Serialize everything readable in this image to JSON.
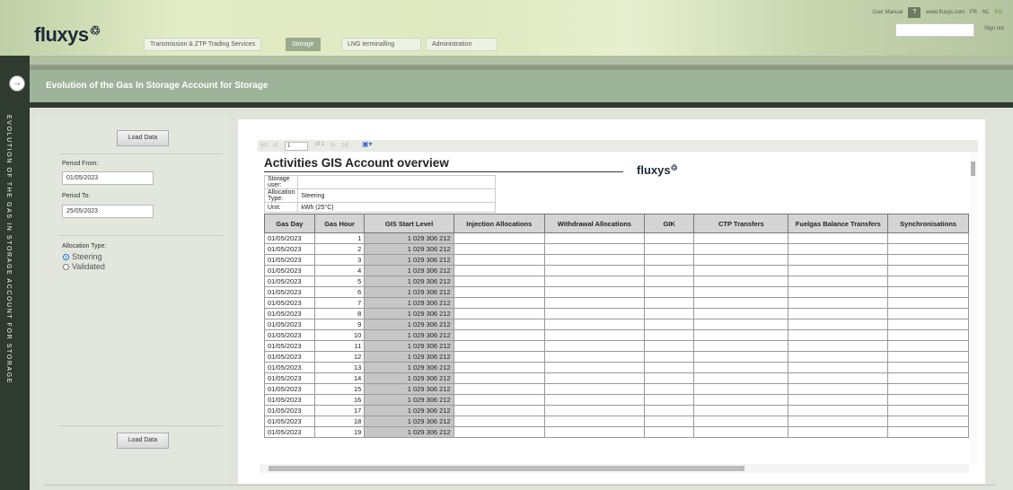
{
  "brand": {
    "logo_text": "fluxys",
    "logo_mark": "♲",
    "brand_color": "#1c2a3a",
    "accent": "#9db39a"
  },
  "nav": {
    "tabs": [
      {
        "label": "Transmission & ZTP Trading Services",
        "active": false
      },
      {
        "label": "Storage",
        "active": true
      },
      {
        "label": "LNG terminalling",
        "active": false
      },
      {
        "label": "Administration",
        "active": false
      }
    ]
  },
  "utility": {
    "user_manual": "User Manual",
    "help": "?",
    "website": "www.fluxys.com",
    "languages": [
      "FR",
      "NL",
      "EN"
    ],
    "active_language": "EN",
    "sign_out": "Sign out"
  },
  "page": {
    "title": "Evolution of the Gas In Storage Account for Storage",
    "side_label": "EVOLUTION OF THE GAS IN STORAGE ACCOUNT FOR STORAGE",
    "expand_icon": "arrow-right-icon"
  },
  "filters": {
    "load_button": "Load Data",
    "period_from_label": "Period From:",
    "period_from_value": "01/05/2023",
    "period_to_label": "Period To:",
    "period_to_value": "25/05/2023",
    "allocation_label": "Allocation Type:",
    "allocation_options": [
      {
        "label": "Steering",
        "selected": true
      },
      {
        "label": "Validated",
        "selected": false
      }
    ]
  },
  "viewer_toolbar": {
    "current_page": "1",
    "page_count_text": "of 1",
    "icons": [
      "first-page-icon",
      "prev-page-icon",
      "next-page-icon",
      "last-page-icon",
      "export-icon"
    ]
  },
  "report": {
    "title": "Activities GIS Account overview",
    "logo_text": "fluxys",
    "meta": [
      {
        "label": "Storage user:",
        "value": ""
      },
      {
        "label": "Allocation Type:",
        "value": "Steering"
      },
      {
        "label": "Unit:",
        "value": "kWh (25°C)"
      }
    ],
    "columns": [
      "Gas Day",
      "Gas Hour",
      "GIS Start Level",
      "Injection Allocations",
      "Withdrawal Allocations",
      "GIK",
      "CTP Transfers",
      "Fuelgas Balance Transfers",
      "Synchronisations"
    ],
    "rows": [
      {
        "day": "01/05/2023",
        "hour": "1",
        "level": "1 029 306 212"
      },
      {
        "day": "01/05/2023",
        "hour": "2",
        "level": "1 029 306 212"
      },
      {
        "day": "01/05/2023",
        "hour": "3",
        "level": "1 029 306 212"
      },
      {
        "day": "01/05/2023",
        "hour": "4",
        "level": "1 029 306 212"
      },
      {
        "day": "01/05/2023",
        "hour": "5",
        "level": "1 029 306 212"
      },
      {
        "day": "01/05/2023",
        "hour": "6",
        "level": "1 029 306 212"
      },
      {
        "day": "01/05/2023",
        "hour": "7",
        "level": "1 029 306 212"
      },
      {
        "day": "01/05/2023",
        "hour": "8",
        "level": "1 029 306 212"
      },
      {
        "day": "01/05/2023",
        "hour": "9",
        "level": "1 029 306 212"
      },
      {
        "day": "01/05/2023",
        "hour": "10",
        "level": "1 029 306 212"
      },
      {
        "day": "01/05/2023",
        "hour": "11",
        "level": "1 029 306 212"
      },
      {
        "day": "01/05/2023",
        "hour": "12",
        "level": "1 029 306 212"
      },
      {
        "day": "01/05/2023",
        "hour": "13",
        "level": "1 029 306 212"
      },
      {
        "day": "01/05/2023",
        "hour": "14",
        "level": "1 029 306 212"
      },
      {
        "day": "01/05/2023",
        "hour": "15",
        "level": "1 029 306 212"
      },
      {
        "day": "01/05/2023",
        "hour": "16",
        "level": "1 029 306 212"
      },
      {
        "day": "01/05/2023",
        "hour": "17",
        "level": "1 029 306 212"
      },
      {
        "day": "01/05/2023",
        "hour": "18",
        "level": "1 029 306 212"
      },
      {
        "day": "01/05/2023",
        "hour": "19",
        "level": "1 029 306 212"
      }
    ]
  }
}
